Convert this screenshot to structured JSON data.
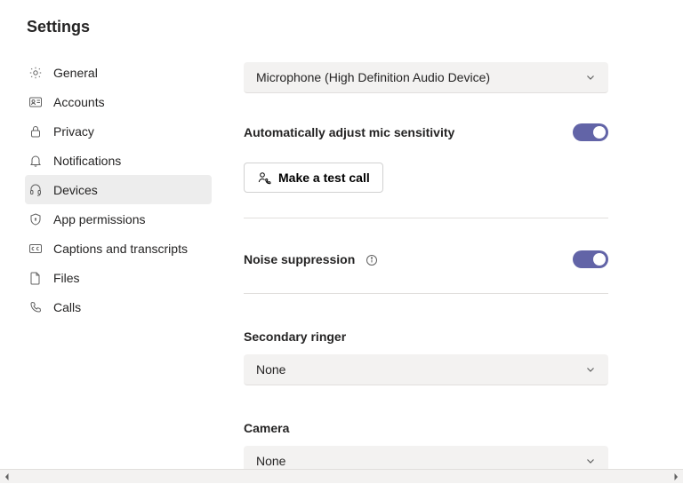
{
  "title": "Settings",
  "sidebar": {
    "items": [
      {
        "id": "general",
        "label": "General"
      },
      {
        "id": "accounts",
        "label": "Accounts"
      },
      {
        "id": "privacy",
        "label": "Privacy"
      },
      {
        "id": "notifications",
        "label": "Notifications"
      },
      {
        "id": "devices",
        "label": "Devices"
      },
      {
        "id": "app-permissions",
        "label": "App permissions"
      },
      {
        "id": "captions",
        "label": "Captions and transcripts"
      },
      {
        "id": "files",
        "label": "Files"
      },
      {
        "id": "calls",
        "label": "Calls"
      }
    ],
    "active": "devices"
  },
  "main": {
    "microphone_dropdown": {
      "value": "Microphone (High Definition Audio Device)"
    },
    "auto_mic_sensitivity": {
      "label": "Automatically adjust mic sensitivity",
      "on": true
    },
    "test_call": {
      "label": "Make a test call"
    },
    "noise_suppression": {
      "label": "Noise suppression",
      "on": true
    },
    "secondary_ringer": {
      "label": "Secondary ringer",
      "value": "None"
    },
    "camera": {
      "label": "Camera",
      "value": "None"
    }
  }
}
